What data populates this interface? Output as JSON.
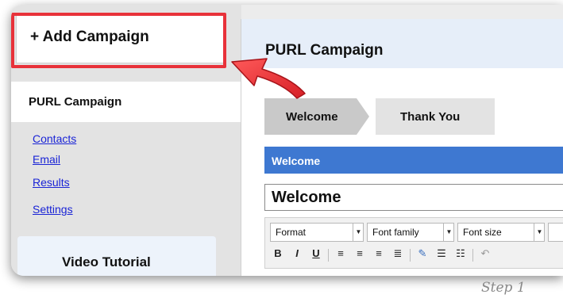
{
  "sidebar": {
    "add_campaign_label": "+ Add Campaign",
    "active_campaign": "PURL Campaign",
    "links": [
      "Contacts",
      "Email",
      "Results",
      "Settings"
    ],
    "video_tutorial_label": "Video Tutorial"
  },
  "main": {
    "title": "PURL Campaign",
    "steps": [
      {
        "label": "Welcome",
        "active": true
      },
      {
        "label": "Thank You",
        "active": false
      }
    ],
    "section_bar_label": "Welcome",
    "title_field_value": "Welcome",
    "toolbar": {
      "format_label": "Format",
      "font_family_label": "Font family",
      "font_size_label": "Font size"
    }
  },
  "caption": "Step 1",
  "colors": {
    "highlight": "#e8323a",
    "link": "#1a24d6",
    "section_bar": "#3e78d1",
    "header_bg": "#e6eef9"
  },
  "icons": [
    "bold-icon",
    "italic-icon",
    "underline-icon",
    "align-left-icon",
    "align-center-icon",
    "align-right-icon",
    "justify-icon",
    "edit-icon",
    "bullet-list-icon",
    "numbered-list-icon",
    "undo-icon",
    "callout-arrow-icon"
  ]
}
